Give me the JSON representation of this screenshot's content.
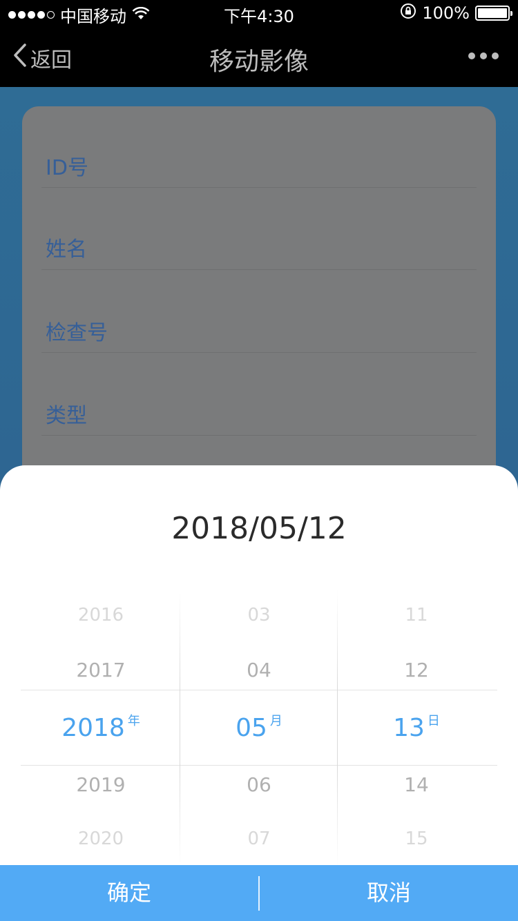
{
  "status_bar": {
    "carrier": "中国移动",
    "time": "下午4:30",
    "battery": "100%",
    "signal_bars_filled": 4,
    "signal_bars_total": 5
  },
  "nav": {
    "back_label": "返回",
    "title": "移动影像",
    "more_icon": "more-dots-icon"
  },
  "form": {
    "fields": [
      {
        "label": "ID号"
      },
      {
        "label": "姓名"
      },
      {
        "label": "检查号"
      },
      {
        "label": "类型"
      }
    ]
  },
  "picker": {
    "title": "2018/05/12",
    "year": {
      "items": [
        "2016",
        "2017",
        "2018",
        "2019",
        "2020"
      ],
      "selected": "2018",
      "unit": "年"
    },
    "month": {
      "items": [
        "03",
        "04",
        "05",
        "06",
        "07"
      ],
      "selected": "05",
      "unit": "月"
    },
    "day": {
      "items": [
        "11",
        "12",
        "13",
        "14",
        "15"
      ],
      "selected": "13",
      "unit": "日"
    }
  },
  "actions": {
    "confirm_label": "确定",
    "cancel_label": "取消"
  },
  "colors": {
    "accent": "#4aa3ee",
    "button_bar": "#52aaf5",
    "label_blue": "#365f98"
  }
}
